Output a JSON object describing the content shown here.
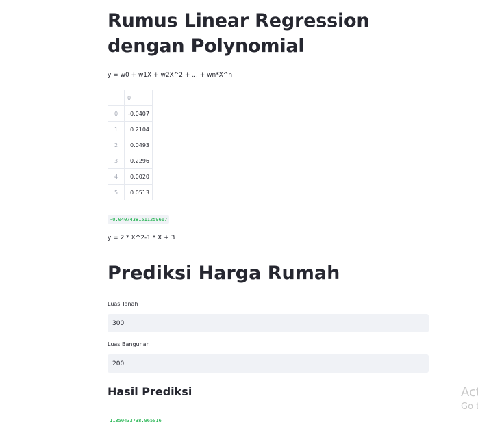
{
  "section1": {
    "title": "Rumus Linear Regression dengan Polynomial",
    "formula": "y = w0 + w1X + w2X^2 + ... + wn*X^n"
  },
  "coef_table": {
    "column_header": "0",
    "rows": [
      {
        "index": "0",
        "value": "-0.0407"
      },
      {
        "index": "1",
        "value": "0.2104"
      },
      {
        "index": "2",
        "value": "0.0493"
      },
      {
        "index": "3",
        "value": "0.2296"
      },
      {
        "index": "4",
        "value": "0.0020"
      },
      {
        "index": "5",
        "value": "0.0513"
      }
    ]
  },
  "intercept_value": "-0.04074381511259667",
  "formula2": "y = 2 * X^2-1 * X + 3",
  "section2": {
    "title": "Prediksi Harga Rumah",
    "luas_tanah": {
      "label": "Luas Tanah",
      "value": "300"
    },
    "luas_bangunan": {
      "label": "Luas Bangunan",
      "value": "200"
    },
    "result_title": "Hasil Prediksi",
    "result_value": "11350433738.965016"
  },
  "watermark": {
    "line1": "Act",
    "line2": "Go t"
  }
}
